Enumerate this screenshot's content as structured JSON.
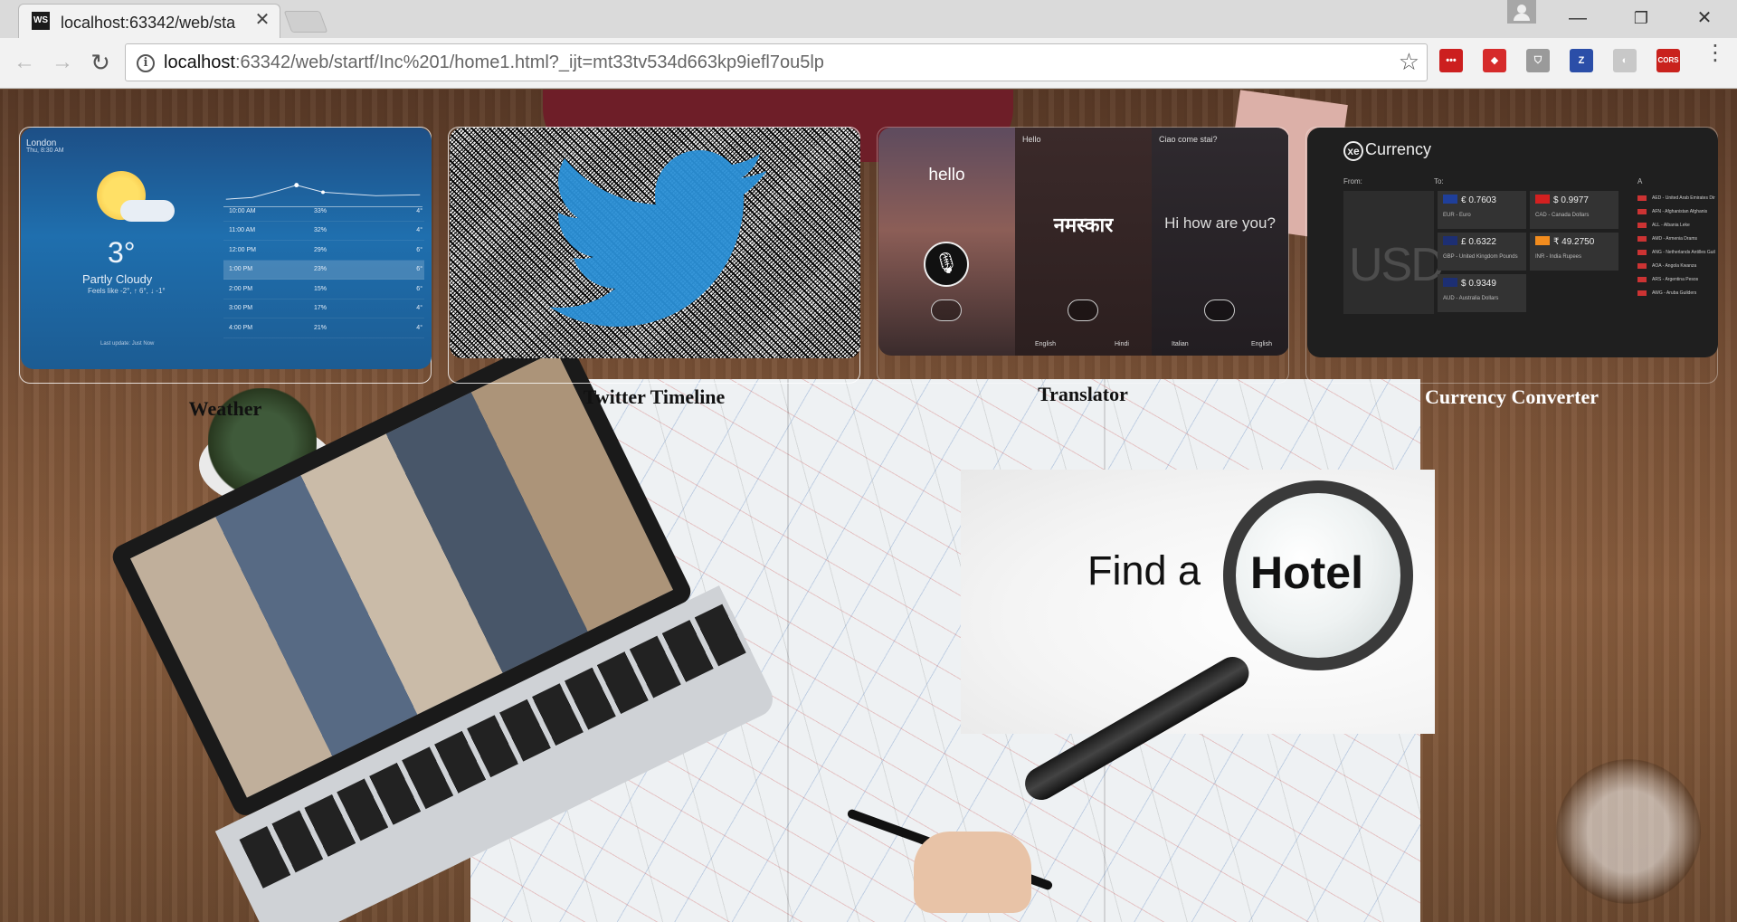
{
  "browser": {
    "tab_title": "localhost:63342/web/sta",
    "tab_favicon": "WS",
    "close_glyph": "✕",
    "url_host": "localhost",
    "url_rest": ":63342/web/startf/Inc%201/home1.html?_ijt=mt33tv534d663kp9iefl7ou5lp",
    "extensions": [
      {
        "name": "lastpass-icon",
        "label": "•••",
        "color": "#cc1f1f"
      },
      {
        "name": "ublock-icon",
        "label": "◆",
        "color": "#d62b2b"
      },
      {
        "name": "shield-icon",
        "label": "⛉",
        "color": "#9a9a9a"
      },
      {
        "name": "zotero-icon",
        "label": "Z",
        "color": "#2b4ea8"
      },
      {
        "name": "ghost-icon",
        "label": "◐",
        "color": "#c8c8c8"
      },
      {
        "name": "cors-icon",
        "label": "CORS",
        "color": "#c9221d"
      }
    ]
  },
  "cards": {
    "weather": {
      "caption": "Weather",
      "location": "London",
      "date": "Thu, 8:30 AM",
      "temp": "3°",
      "condition": "Partly Cloudy",
      "feels": "Feels like -2°, ↑ 6°, ↓ -1°",
      "updated": "Last update: Just Now",
      "hours": [
        {
          "time": "10:00 AM",
          "pct": "33%",
          "deg": "4°"
        },
        {
          "time": "11:00 AM",
          "pct": "32%",
          "deg": "4°"
        },
        {
          "time": "12:00 PM",
          "pct": "29%",
          "deg": "6°"
        },
        {
          "time": "1:00 PM",
          "pct": "23%",
          "deg": "6°"
        },
        {
          "time": "2:00 PM",
          "pct": "15%",
          "deg": "6°"
        },
        {
          "time": "3:00 PM",
          "pct": "17%",
          "deg": "4°"
        },
        {
          "time": "4:00 PM",
          "pct": "21%",
          "deg": "4°"
        }
      ]
    },
    "twitter": {
      "caption": "Twitter Timeline"
    },
    "translator": {
      "caption": "Translator",
      "panel1_word": "hello",
      "panel2_top": "Hello",
      "panel2_word": "नमस्कार",
      "panel3_top": "Ciao come stai?",
      "panel3_word": "Hi how are you?",
      "langs": [
        "English",
        "Hindi",
        "Italian",
        "English"
      ]
    },
    "currency": {
      "caption": "Currency Converter",
      "logo_mark": "xe",
      "logo_text": "Currency",
      "from_label": "From:",
      "to_label": "To:",
      "a_label": "A",
      "base": "USD",
      "tiles": [
        {
          "value": "€ 0.7603",
          "name": "EUR - Euro",
          "flag": "#1f3f9a"
        },
        {
          "value": "$ 0.9977",
          "name": "CAD - Canada Dollars",
          "flag": "#d32020"
        },
        {
          "value": "£ 0.6322",
          "name": "GBP - United Kingdom Pounds",
          "flag": "#1d2f73"
        },
        {
          "value": "₹ 49.2750",
          "name": "INR - India Rupees",
          "flag": "#f28c1e"
        },
        {
          "value": "$ 0.9349",
          "name": "AUD - Australia Dollars",
          "flag": "#1d2f73"
        }
      ],
      "list": [
        "AED - United Arab Emirates Dirham",
        "AFN - Afghanistan Afghanis",
        "ALL - Albania Leke",
        "AMD - Armenia Drams",
        "ANG - Netherlands Antilles Guilders",
        "AOA - Angola Kwanza",
        "ARS - Argentina Pesos",
        "AWG - Aruba Guilders"
      ]
    }
  },
  "hotel": {
    "find": "Find a",
    "word": "Hotel"
  }
}
